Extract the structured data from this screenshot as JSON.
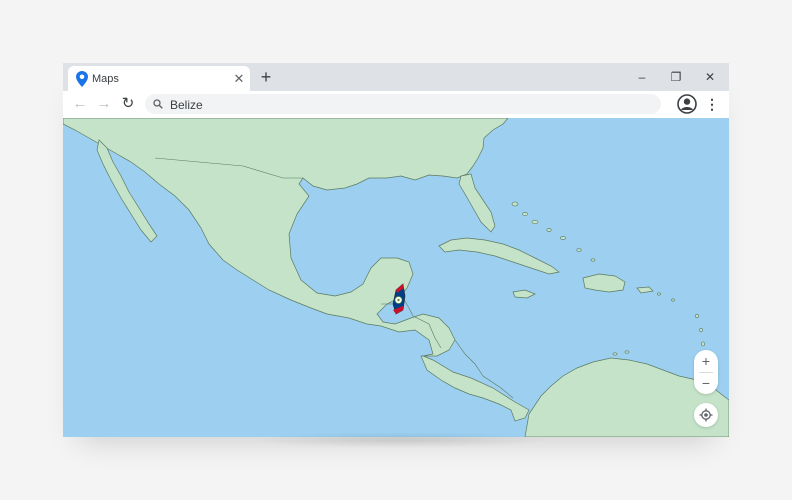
{
  "tab": {
    "title": "Maps",
    "icon": "map-pin-icon",
    "pin_color": "#1a73e8"
  },
  "window_controls": {
    "new_tab": "+",
    "minimize": "–",
    "restore": "❐",
    "close": "✕"
  },
  "toolbar": {
    "back": "←",
    "forward": "→",
    "reload": "↻",
    "search_query": "Belize",
    "menu": "⋮"
  },
  "map": {
    "land_color": "#c4e3c8",
    "water_color": "#9ccff0",
    "border_color": "#5b7a60",
    "highlighted_country": "Belize",
    "highlight_icon": "belize-flag-icon"
  },
  "map_controls": {
    "zoom_in": "+",
    "zoom_out": "−"
  }
}
